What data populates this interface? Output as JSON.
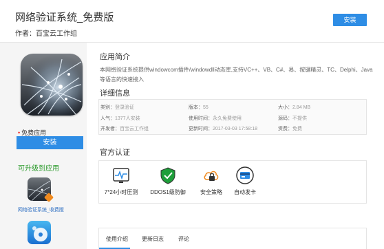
{
  "app": {
    "title": "网络验证系统_免费版",
    "author": "作者：百宝云工作组",
    "install_label": "安装"
  },
  "sidebar": {
    "free_label": "免费应用",
    "install_label": "安装",
    "upgrade_title": "可升级到应用",
    "upgrade_items": [
      {
        "label": "网络验证系统_收费版"
      },
      {
        "label": ""
      }
    ]
  },
  "intro": {
    "title": "应用简介",
    "text": "本网络验证系统提供windowcom插件/windowdll动态库,支持VC++、VB、C#、易、按键精灵、TC、Delphi、Java等语言的快速接入"
  },
  "details": {
    "title": "详细信息",
    "rows": [
      [
        {
          "k": "类别：",
          "v": "登录验证"
        },
        {
          "k": "版本：",
          "v": "55"
        },
        {
          "k": "大小：",
          "v": "2.84 MB"
        }
      ],
      [
        {
          "k": "人气：",
          "v": "1377人安装"
        },
        {
          "k": "使用时间：",
          "v": "永久免费使用"
        },
        {
          "k": "源码：",
          "v": "不提供"
        }
      ],
      [
        {
          "k": "开发者：",
          "v": "百宝云工作组"
        },
        {
          "k": "更新时间：",
          "v": "2017-03-03 17:58:18"
        },
        {
          "k": "资费：",
          "v": "免费"
        }
      ]
    ]
  },
  "certification": {
    "title": "官方认证",
    "items": [
      {
        "label": "7*24小时压测",
        "icon": "pulse-monitor-icon"
      },
      {
        "label": "DDOS1级防御",
        "icon": "shield-check-icon"
      },
      {
        "label": "安全策略",
        "icon": "cloud-lock-icon"
      },
      {
        "label": "自动发卡",
        "icon": "card-icon"
      }
    ]
  },
  "tabs": [
    "使用介绍",
    "更新日志",
    "评论"
  ],
  "colors": {
    "accent": "#2e8de5",
    "green": "#2a9a2a",
    "shield": "#1e9e3a",
    "orange": "#f08a1e"
  }
}
